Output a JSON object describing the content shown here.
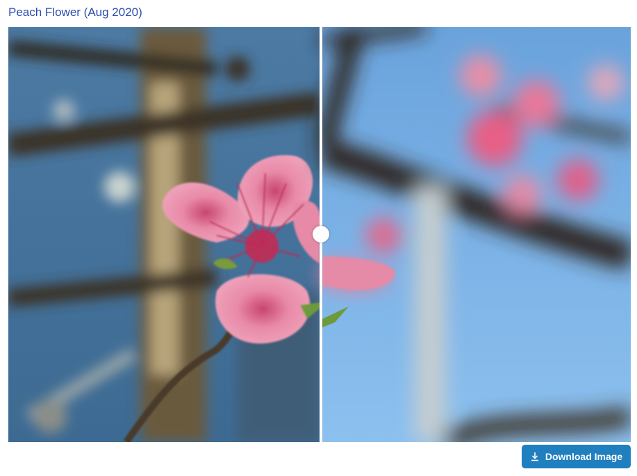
{
  "title": "Peach Flower (Aug 2020)",
  "viewer": {
    "left_image": "peach-flower-in-focus",
    "right_image": "peach-flower-blurred",
    "slider_position_fraction": 0.5
  },
  "download": {
    "label": "Download Image",
    "icon": "download-icon",
    "color": "#1f7fbf"
  },
  "colors": {
    "title": "#2b4db0",
    "sky": "#6fa3d6",
    "petal": "#e07a9a"
  }
}
